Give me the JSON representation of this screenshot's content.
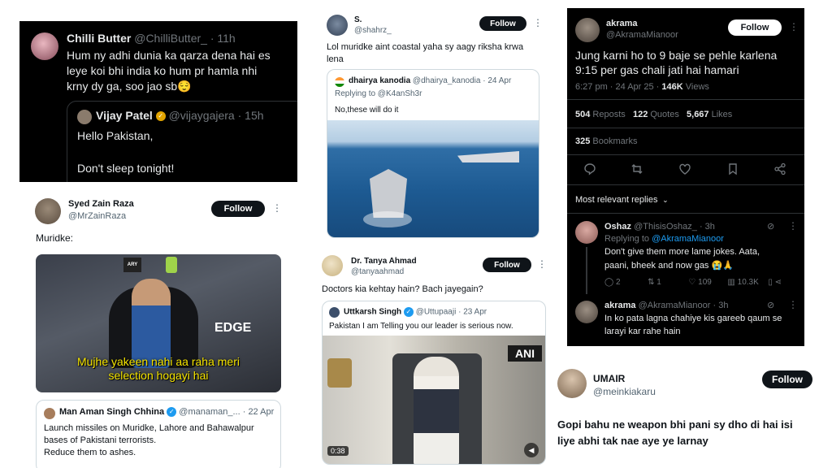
{
  "t1": {
    "name": "Chilli Butter",
    "handle": "@ChilliButter_",
    "time": "· 11h",
    "lines": [
      "Hum ny adhi dunia ka qarza dena hai es",
      "leye koi bhi india ko hum pr hamla nhi",
      "krny dy ga, soo jao sb😌"
    ],
    "quote": {
      "name": "Vijay Patel",
      "handle": "@vijaygajera",
      "time": "· 15h",
      "line1": "Hello Pakistan,",
      "line2": "Don't sleep tonight!"
    }
  },
  "t2": {
    "name": "Syed Zain Raza",
    "handle": "@MrZainRaza",
    "follow": "Follow",
    "text": "Muridke:",
    "caption_line1": "Mujhe yakeen nahi aa raha meri",
    "caption_line2": "selection hogayi hai",
    "media_sign": "EDGE",
    "media_logo": "ARY",
    "quote": {
      "name": "Man Aman Singh Chhina",
      "handle": "@manaman_...",
      "time": "· 22 Apr",
      "lines": [
        "Launch missiles on Muridke, Lahore and Bahawalpur",
        "bases of Pakistani terrorists.",
        "Reduce them to ashes."
      ]
    }
  },
  "t3": {
    "name": "S.",
    "handle": "@shahrz_",
    "follow": "Follow",
    "lines": [
      "Lol muridke aint coastal yaha sy aagy riksha krwa",
      "lena"
    ],
    "quote": {
      "name": "dhairya kanodia",
      "handle": "@dhairya_kanodia",
      "time": "· 24 Apr",
      "reply": "Replying to @K4anSh3r",
      "text": "No,these will do it"
    }
  },
  "t4": {
    "name": "Dr. Tanya Ahmad",
    "handle": "@tanyaahmad",
    "follow": "Follow",
    "text": "Doctors kia kehtay hain? Bach jayegain?",
    "quote": {
      "name": "Uttkarsh Singh",
      "handle": "@Uttupaaji",
      "time": "· 23 Apr",
      "text": "Pakistan I am Telling you our leader is serious now."
    },
    "video_badge": "ANI",
    "video_time": "0:38"
  },
  "t5": {
    "name": "akrama",
    "handle": "@AkramaMianoor",
    "follow": "Follow",
    "line1": "Jung karni ho to 9 baje se pehle karlena",
    "line2": "9:15 per gas chali jati hai hamari",
    "meta": "6:27 pm · 24 Apr 25 ·",
    "views_count": "146K",
    "views_label": "Views",
    "reposts_count": "504",
    "reposts_label": "Reposts",
    "quotes_count": "122",
    "quotes_label": "Quotes",
    "likes_count": "5,667",
    "likes_label": "Likes",
    "bookmarks_count": "325",
    "bookmarks_label": "Bookmarks",
    "replies_sort": "Most relevant replies",
    "reply1": {
      "name": "Oshaz",
      "handle": "@ThisisOshaz_",
      "time": "· 3h",
      "replying_prefix": "Replying to",
      "replying_to": "@AkramaMianoor",
      "line1": "Don't give them more lame jokes. Aata,",
      "line2": "paani, bheek and now gas 😭🙏",
      "replies": "2",
      "reposts": "1",
      "likes": "109",
      "views": "10.3K"
    },
    "reply2": {
      "name": "akrama",
      "handle": "@AkramaMianoor",
      "time": "· 3h",
      "line1": "In ko pata lagna chahiye kis gareeb qaum se",
      "line2": "larayi kar rahe hain"
    }
  },
  "t6": {
    "name": "UMAIR",
    "handle": "@meinkiakaru",
    "follow": "Follow",
    "line1": "Gopi bahu ne weapon bhi pani sy dho di hai isi",
    "line2": "liye abhi tak nae aye ye larnay"
  }
}
